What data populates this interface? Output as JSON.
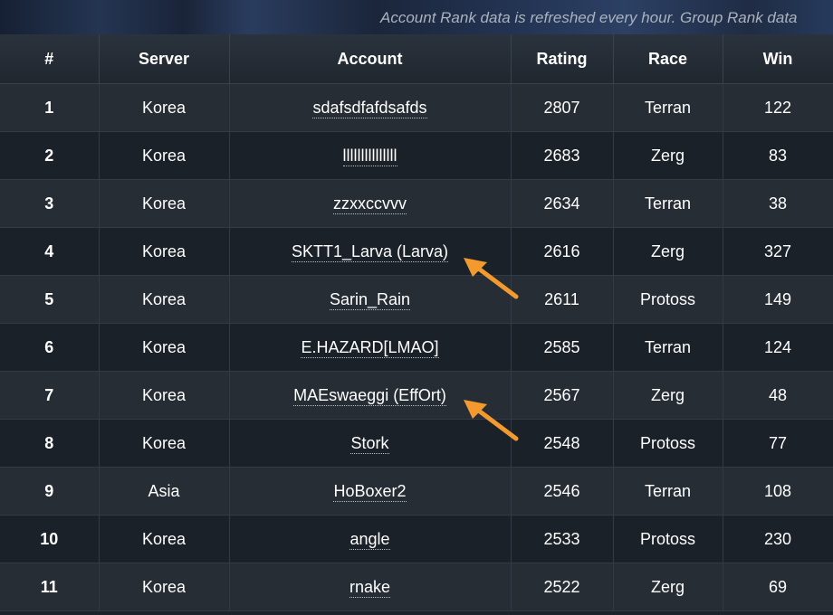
{
  "notice": "Account Rank data is refreshed every hour. Group Rank data",
  "columns": [
    "#",
    "Server",
    "Account",
    "Rating",
    "Race",
    "Win"
  ],
  "rows": [
    {
      "rank": "1",
      "server": "Korea",
      "account": "sdafsdfafdsafds",
      "rating": "2807",
      "race": "Terran",
      "win": "122"
    },
    {
      "rank": "2",
      "server": "Korea",
      "account": "lllllllllllllll",
      "rating": "2683",
      "race": "Zerg",
      "win": "83"
    },
    {
      "rank": "3",
      "server": "Korea",
      "account": "zzxxccvvv",
      "rating": "2634",
      "race": "Terran",
      "win": "38"
    },
    {
      "rank": "4",
      "server": "Korea",
      "account": "SKTT1_Larva (Larva)",
      "rating": "2616",
      "race": "Zerg",
      "win": "327"
    },
    {
      "rank": "5",
      "server": "Korea",
      "account": "Sarin_Rain",
      "rating": "2611",
      "race": "Protoss",
      "win": "149"
    },
    {
      "rank": "6",
      "server": "Korea",
      "account": "E.HAZARD[LMAO]",
      "rating": "2585",
      "race": "Terran",
      "win": "124"
    },
    {
      "rank": "7",
      "server": "Korea",
      "account": "MAEswaeggi (EffOrt)",
      "rating": "2567",
      "race": "Zerg",
      "win": "48"
    },
    {
      "rank": "8",
      "server": "Korea",
      "account": "Stork",
      "rating": "2548",
      "race": "Protoss",
      "win": "77"
    },
    {
      "rank": "9",
      "server": "Asia",
      "account": "HoBoxer2",
      "rating": "2546",
      "race": "Terran",
      "win": "108"
    },
    {
      "rank": "10",
      "server": "Korea",
      "account": "angle",
      "rating": "2533",
      "race": "Protoss",
      "win": "230"
    },
    {
      "rank": "11",
      "server": "Korea",
      "account": "rnake",
      "rating": "2522",
      "race": "Zerg",
      "win": "69"
    }
  ],
  "annotations": {
    "arrow_color": "#f39a2e",
    "highlighted_accounts": [
      "SKTT1_Larva (Larva)",
      "MAEswaeggi (EffOrt)"
    ]
  }
}
